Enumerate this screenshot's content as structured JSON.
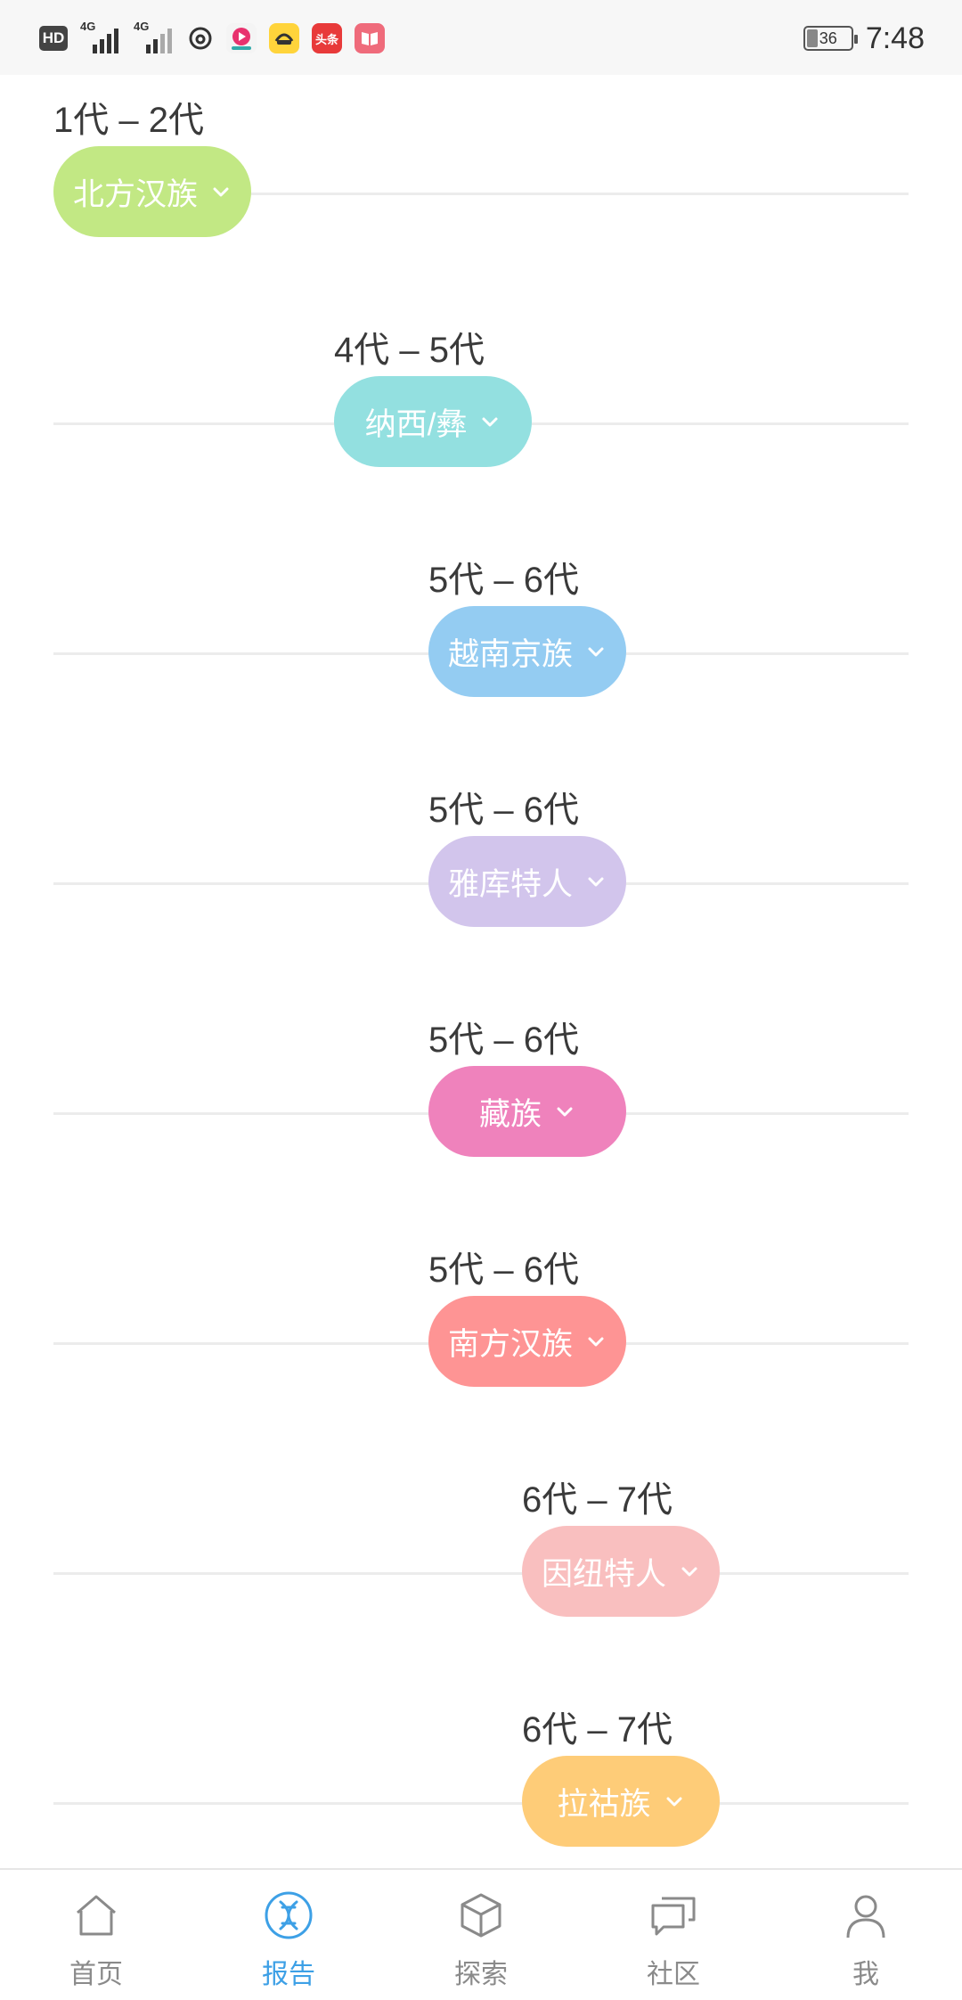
{
  "status_bar": {
    "hd": "HD",
    "net1": "4G",
    "net2": "4G",
    "app_badge_toutiao": "头条",
    "battery": "36",
    "time": "7:48"
  },
  "timeline": [
    {
      "generation": "1代 – 2代",
      "ethnicity": "北方汉族",
      "color": "#c2e884"
    },
    {
      "generation": "4代 – 5代",
      "ethnicity": "纳西/彝",
      "color": "#93e0e0"
    },
    {
      "generation": "5代 – 6代",
      "ethnicity": "越南京族",
      "color": "#94ccf2"
    },
    {
      "generation": "5代 – 6代",
      "ethnicity": "雅库特人",
      "color": "#d2c5ec"
    },
    {
      "generation": "5代 – 6代",
      "ethnicity": "藏族",
      "color": "#ef82bc"
    },
    {
      "generation": "5代 – 6代",
      "ethnicity": "南方汉族",
      "color": "#fe9494"
    },
    {
      "generation": "6代 – 7代",
      "ethnicity": "因纽特人",
      "color": "#f9bfbf"
    },
    {
      "generation": "6代 – 7代",
      "ethnicity": "拉祜族",
      "color": "#fecc78"
    }
  ],
  "nav": {
    "items": [
      {
        "label": "首页",
        "icon": "home-icon"
      },
      {
        "label": "报告",
        "icon": "dna-icon",
        "active": true
      },
      {
        "label": "探索",
        "icon": "cube-icon"
      },
      {
        "label": "社区",
        "icon": "chat-bubbles-icon"
      },
      {
        "label": "我",
        "icon": "person-icon"
      }
    ],
    "active_color": "#3da0e6",
    "inactive_color": "#8a8a8a"
  }
}
